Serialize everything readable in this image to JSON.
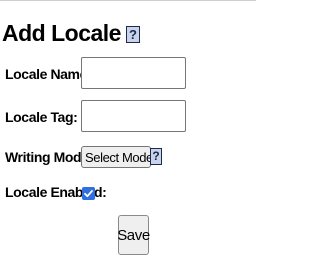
{
  "form": {
    "title": "Add Locale",
    "help_glyph": "?",
    "fields": {
      "locale_name": {
        "label": "Locale Name:",
        "value": "",
        "placeholder": ""
      },
      "locale_tag": {
        "label": "Locale Tag:",
        "value": "",
        "placeholder": ""
      },
      "writing_mode": {
        "label": "Writing Mode:",
        "selected": "Select Mode",
        "help_glyph": "?"
      },
      "locale_enabled": {
        "label": "Locale Enabled:",
        "checked": true
      }
    },
    "save_label": "Save"
  },
  "colors": {
    "help_bg": "#c9d3ec",
    "help_border": "#1a2a4a",
    "checkbox_accent": "#2f6fe0",
    "button_bg": "#efefef"
  },
  "icons": {
    "help": "help-icon",
    "dropdown": "chevron-down-icon",
    "check": "checkmark-icon"
  }
}
